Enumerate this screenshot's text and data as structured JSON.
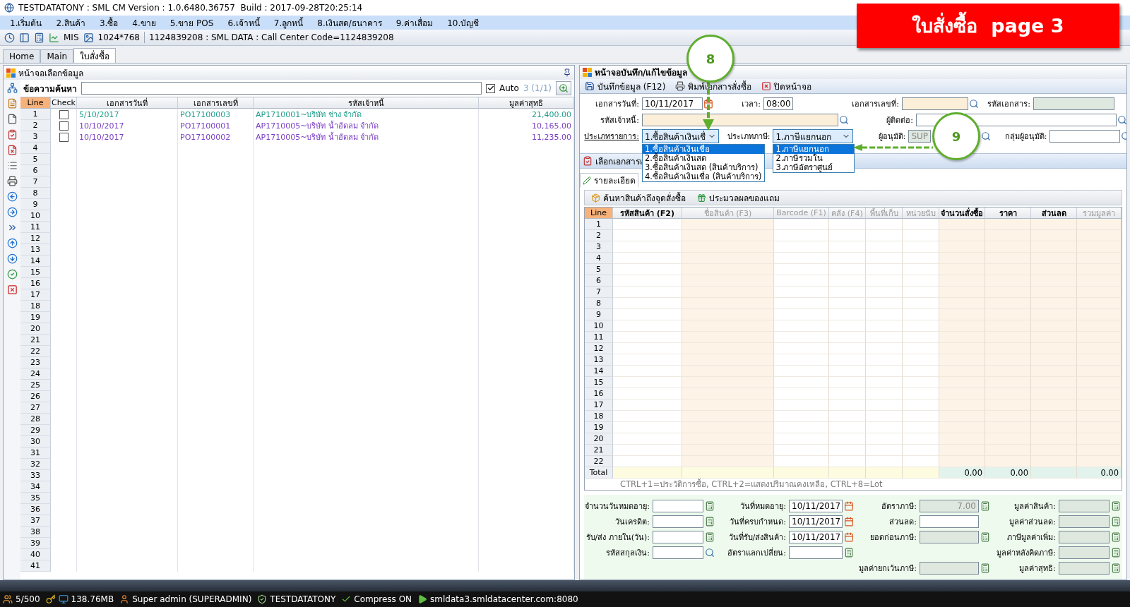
{
  "window": {
    "title": "TESTDATATONY : SML CM Version : 1.0.6480.36757  Build : 2017-09-28T20:25:14"
  },
  "menu": [
    "1.เริ่มต้น",
    "2.สินค้า",
    "3.ซื้อ",
    "4.ขาย",
    "5.ขาย POS",
    "6.เจ้าหนี้",
    "7.ลูกหนี้",
    "8.เงินสด/ธนาคาร",
    "9.ค่าเสื่อม",
    "10.บัญชี"
  ],
  "toolbar": {
    "mis": "MIS",
    "resolution": "1024*768",
    "info": "1124839208 : SML DATA : Call Center Code=1124839208"
  },
  "tabs": [
    {
      "label": "Home",
      "selected": false
    },
    {
      "label": "Main",
      "selected": false
    },
    {
      "label": "ใบสั่งซื้อ",
      "selected": true
    }
  ],
  "banner": "ใบสั่งซื้อ  page 3",
  "annotations": [
    {
      "label": "8"
    },
    {
      "label": "9"
    }
  ],
  "left_panel": {
    "title": "หน้าจอเลือกข้อมูล",
    "search": {
      "label": "ข้อความค้นหา",
      "auto": {
        "label": "Auto",
        "checked": true
      },
      "count": "3 (1/1)"
    },
    "columns": [
      "Line",
      "Check",
      "เอกสารวันที่",
      "เอกสารเลขที่",
      "รหัสเจ้าหนี้",
      "มูลค่าสุทธิ"
    ],
    "rows": [
      {
        "line": "1",
        "checked": false,
        "date": "5/10/2017",
        "doc": "PO17100003",
        "creditor": "AP1710001~บริษัท ช่าง จำกัด",
        "value": "21,400.00",
        "color": "#1e9e8c"
      },
      {
        "line": "2",
        "checked": false,
        "date": "10/10/2017",
        "doc": "PO17100001",
        "creditor": "AP1710005~บริษัท น้ำอัดลม จำกัด",
        "value": "10,165.00",
        "color": "#7a3fc4"
      },
      {
        "line": "3",
        "checked": false,
        "date": "10/10/2017",
        "doc": "PO17100002",
        "creditor": "AP1710005~บริษัท น้ำอัดลม จำกัด",
        "value": "11,235.00",
        "color": "#7a3fc4"
      },
      {
        "line": "4"
      },
      {
        "line": "5"
      },
      {
        "line": "6"
      },
      {
        "line": "7"
      },
      {
        "line": "8"
      },
      {
        "line": "9"
      },
      {
        "line": "10"
      },
      {
        "line": "11"
      },
      {
        "line": "12"
      },
      {
        "line": "13"
      },
      {
        "line": "14"
      },
      {
        "line": "15"
      },
      {
        "line": "16"
      },
      {
        "line": "17"
      },
      {
        "line": "18"
      },
      {
        "line": "19"
      },
      {
        "line": "20"
      },
      {
        "line": "21"
      },
      {
        "line": "22"
      },
      {
        "line": "23"
      },
      {
        "line": "24"
      },
      {
        "line": "25"
      },
      {
        "line": "26"
      },
      {
        "line": "27"
      },
      {
        "line": "28"
      },
      {
        "line": "29"
      },
      {
        "line": "30"
      },
      {
        "line": "31"
      },
      {
        "line": "32"
      },
      {
        "line": "33"
      },
      {
        "line": "34"
      },
      {
        "line": "35"
      },
      {
        "line": "36"
      },
      {
        "line": "37"
      },
      {
        "line": "38"
      },
      {
        "line": "39"
      },
      {
        "line": "40"
      },
      {
        "line": "41"
      }
    ]
  },
  "right_panel": {
    "title": "หน้าจอบันทึก/แก้ไขข้อมูล",
    "actions": [
      {
        "label": "บันทึกข้อมูล (F12)",
        "kind": "save"
      },
      {
        "label": "พิมพ์เอกสารสั่งซื้อ",
        "kind": "print"
      },
      {
        "label": "ปิดหน้าจอ",
        "kind": "close"
      }
    ],
    "header_form": {
      "doc_date": {
        "label": "เอกสารวันที่:",
        "value": "10/11/2017"
      },
      "time": {
        "label": "เวลา:",
        "value": "08:00"
      },
      "doc_no": {
        "label": "เอกสารเลขที่:",
        "required": true
      },
      "doc_code": {
        "label": "รหัสเอกสาร:",
        "readonly": true
      },
      "creditor": {
        "label": "รหัสเจ้าหนี้:",
        "required": true
      },
      "contact": {
        "label": "ผู้ติดต่อ:",
        "required": false
      },
      "item_type": {
        "label": "ประเภทรายการ:",
        "value": "1.ซื้อสินค้าเงินเชื่",
        "expanded": true,
        "options": [
          {
            "label": "1.ซื้อสินค้าเงินเชื่อ",
            "selected": true
          },
          {
            "label": "2.ซื้อสินค้าเงินสด",
            "selected": false
          },
          {
            "label": "3.ซื้อสินค้าเงินสด (สินค้าบริการ)",
            "selected": false
          },
          {
            "label": "4.ซื้อสินค้าเงินเชื่อ (สินค้าบริการ)",
            "selected": false
          }
        ]
      },
      "tax_type": {
        "label": "ประเภทภาษี:",
        "value": "1.ภาษีแยกนอก",
        "expanded": true,
        "options": [
          {
            "label": "1.ภาษีแยกนอก",
            "selected": true
          },
          {
            "label": "2.ภาษีรวมใน",
            "selected": false
          },
          {
            "label": "3.ภาษีอัตราศูนย์",
            "selected": false
          }
        ]
      },
      "approver": {
        "label": "ผู้อนุมัติ:",
        "value": "SUP"
      },
      "approver_group": {
        "label": "กลุ่มผู้อนุมัติ:"
      }
    },
    "select_doc": "เลือกเอกสารเ",
    "detail_tab": "รายละเอียด",
    "tools": [
      {
        "label": "ค้นหาสินค้าถึงจุดสั่งซื้อ",
        "kind": "box"
      },
      {
        "label": "ประมวลผลของแถม",
        "kind": "gift"
      }
    ],
    "items_table": {
      "columns": [
        {
          "label": "Line",
          "disabled": false
        },
        {
          "label": "รหัสสินค้า (F2)",
          "disabled": false
        },
        {
          "label": "ชื่อสินค้า (F3)",
          "disabled": true
        },
        {
          "label": "Barcode (F1)",
          "disabled": true
        },
        {
          "label": "คลัง (F4)",
          "disabled": true
        },
        {
          "label": "พื้นที่เก็บ",
          "disabled": true
        },
        {
          "label": "หน่วยนับ",
          "disabled": true
        },
        {
          "label": "จำนวนสั่งซื้อ",
          "disabled": false,
          "total": "0.00"
        },
        {
          "label": "ราคา",
          "disabled": false,
          "total": "0.00"
        },
        {
          "label": "ส่วนลด",
          "disabled": false
        },
        {
          "label": "รวมมูลค่า",
          "disabled": true,
          "total": "0.00"
        }
      ],
      "rows": [
        "1",
        "2",
        "3",
        "4",
        "5",
        "6",
        "7",
        "8",
        "9",
        "10",
        "11",
        "12",
        "13",
        "14",
        "15",
        "16",
        "17",
        "18",
        "19",
        "20",
        "21",
        "22"
      ],
      "total_label": "Total",
      "hint": "CTRL+1=ประวัติการซื้อ, CTRL+2=แสดงปริมาณคงเหลือ, CTRL+8=Lot"
    },
    "summary": [
      [
        {
          "kind": "calc_field",
          "label": "จำนวนวันหมดอายุ:",
          "readonly": false
        },
        {
          "kind": "date_field",
          "label": "วันที่หมดอายุ:",
          "value": "10/11/2017",
          "readonly": false
        },
        {
          "kind": "calc_field",
          "label": "อัตราภาษี:",
          "value": "7.00",
          "readonly": true
        },
        {
          "kind": "calc_field",
          "label": "มูลค่าสินค้า:",
          "readonly": true
        }
      ],
      [
        {
          "kind": "calc_field",
          "label": "วันเครดิต:",
          "readonly": false
        },
        {
          "kind": "date_field",
          "label": "วันที่ครบกำหนด:",
          "value": "10/11/2017",
          "readonly": false
        },
        {
          "kind": "plain_field",
          "label": "ส่วนลด:",
          "readonly": false
        },
        {
          "kind": "calc_field",
          "label": "มูลค่าส่วนลด:",
          "readonly": true
        }
      ],
      [
        {
          "kind": "calc_field",
          "label": "รับ/ส่ง ภายใน(วัน):",
          "readonly": false
        },
        {
          "kind": "date_field",
          "label": "วันที่รับ/ส่งสินค้า:",
          "value": "10/11/2017",
          "readonly": false
        },
        {
          "kind": "calc_field",
          "label": "ยอดก่อนภาษี:",
          "readonly": true
        },
        {
          "kind": "calc_field",
          "label": "ภาษีมูลค่าเพิ่ม:",
          "readonly": true
        }
      ],
      [
        {
          "kind": "search_field",
          "label": "รหัสสกุลเงิน:",
          "readonly": false
        },
        {
          "kind": "calc_field",
          "label": "อัตราแลกเปลี่ยน:",
          "readonly": false
        },
        {
          "kind": "blank"
        },
        {
          "kind": "calc_field",
          "label": "มูลค่าหลังคิดภาษี:",
          "readonly": true
        }
      ],
      [
        {
          "kind": "blank"
        },
        {
          "kind": "blank"
        },
        {
          "kind": "calc_field",
          "label": "มูลค่ายกเว้นภาษี:",
          "readonly": true
        },
        {
          "kind": "calc_field",
          "label": "มูลค่าสุทธิ:",
          "readonly": true
        }
      ]
    ]
  },
  "status_bar": [
    {
      "kind": "users",
      "text": "5/500"
    },
    {
      "kind": "memory",
      "text": "138.76MB"
    },
    {
      "kind": "user",
      "text": "Super admin (SUPERADMIN)"
    },
    {
      "kind": "database",
      "text": "TESTDATATONY"
    },
    {
      "kind": "compress",
      "text": "Compress ON"
    },
    {
      "kind": "server",
      "text": "smldata3.smldatacenter.com:8080"
    }
  ]
}
